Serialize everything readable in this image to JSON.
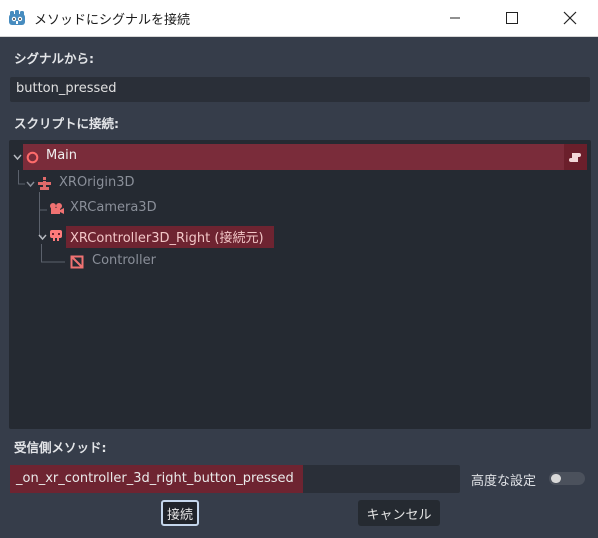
{
  "window": {
    "title": "メソッドにシグナルを接続",
    "controls": {
      "minimize": "minimize-icon",
      "maximize": "maximize-icon",
      "close": "close-icon"
    }
  },
  "signal": {
    "label": "シグナルから:",
    "value": "button_pressed"
  },
  "script": {
    "label": "スクリプトに接続:",
    "tree": [
      {
        "label": "Main",
        "icon": "node-circle-icon",
        "selected": true,
        "script_icon": "script-icon"
      },
      {
        "label": "XROrigin3D",
        "icon": "xr-origin-icon"
      },
      {
        "label": "XRCamera3D",
        "icon": "camera-icon"
      },
      {
        "label": "XRController3D_Right (接続元)",
        "icon": "xr-controller-icon",
        "source": true
      },
      {
        "label": "Controller",
        "icon": "mesh-instance-icon"
      }
    ]
  },
  "receiver": {
    "label": "受信側メソッド:",
    "value": "_on_xr_controller_3d_right_button_pressed",
    "advanced_label": "高度な設定",
    "advanced_on": false
  },
  "buttons": {
    "connect": "接続",
    "cancel": "キャンセル"
  },
  "colors": {
    "background": "#363d4a",
    "tree_bg": "#252a32",
    "selection": "#7a2c3a",
    "accent_red": "#ff5f5f"
  }
}
